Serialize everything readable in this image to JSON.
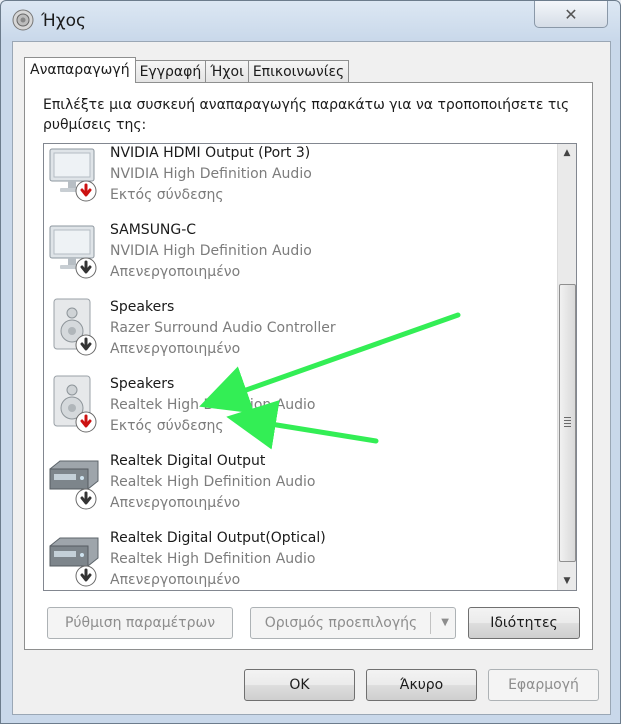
{
  "window": {
    "title": "Ήχος",
    "close_label": "✕"
  },
  "tabs": [
    {
      "label": "Αναπαραγωγή"
    },
    {
      "label": "Εγγραφή"
    },
    {
      "label": "Ήχοι"
    },
    {
      "label": "Επικοινωνίες"
    }
  ],
  "description": "Επιλέξτε μια συσκευή αναπαραγωγής παρακάτω για να τροποποιήσετε τις ρυθμίσεις της:",
  "devices": [
    {
      "name": "NVIDIA HDMI Output (Port 3)",
      "description": "NVIDIA High Definition Audio",
      "status": "Εκτός σύνδεσης",
      "icon": "monitor-icon"
    },
    {
      "name": "SAMSUNG-C",
      "description": "NVIDIA High Definition Audio",
      "status": "Απενεργοποιημένο",
      "icon": "monitor-icon"
    },
    {
      "name": "Speakers",
      "description": "Razer Surround Audio Controller",
      "status": "Απενεργοποιημένο",
      "icon": "speaker-icon"
    },
    {
      "name": "Speakers",
      "description": "Realtek High Definition Audio",
      "status": "Εκτός σύνδεσης",
      "icon": "speaker-icon"
    },
    {
      "name": "Realtek Digital Output",
      "description": "Realtek High Definition Audio",
      "status": "Απενεργοποιημένο",
      "icon": "digital-output-icon"
    },
    {
      "name": "Realtek Digital Output(Optical)",
      "description": "Realtek High Definition Audio",
      "status": "Απενεργοποιημένο",
      "icon": "digital-output-icon"
    }
  ],
  "buttons": {
    "configure": "Ρύθμιση παραμέτρων",
    "set_default": "Ορισμός προεπιλογής",
    "properties": "Ιδιότητες",
    "ok": "OK",
    "cancel": "Άκυρο",
    "apply": "Εφαρμογή"
  },
  "colors": {
    "annotation_arrow": "#33ee55",
    "offline_badge": "#cc1111",
    "disabled_badge": "#333333"
  }
}
